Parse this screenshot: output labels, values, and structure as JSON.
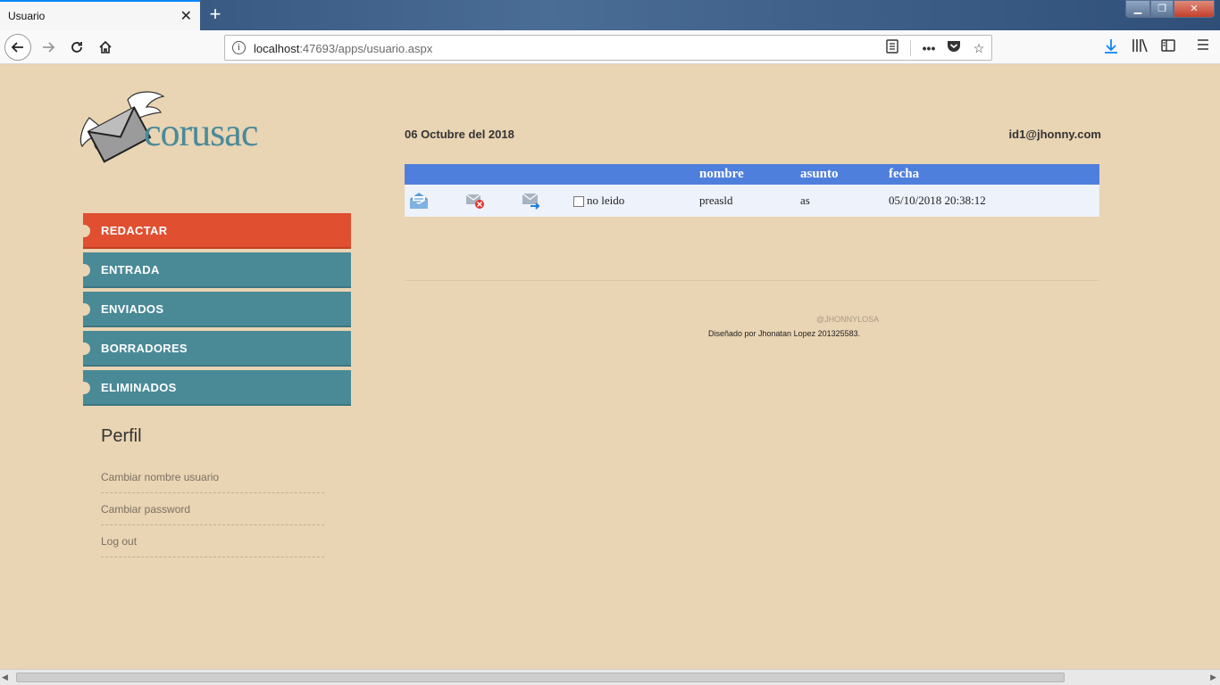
{
  "browser": {
    "tab_title": "Usuario",
    "tab_close": "✕",
    "new_tab": "+",
    "url_host": "localhost",
    "url_rest": ":47693/apps/usuario.aspx",
    "icons": [
      "back-icon",
      "forward-icon",
      "reload-icon",
      "home-icon",
      "info-icon",
      "reader-icon",
      "more-icon",
      "pocket-icon",
      "star-icon",
      "download-icon",
      "library-icon",
      "sidebar-icon",
      "menu-icon"
    ]
  },
  "header": {
    "logo_text": "corusac",
    "date": "06 Octubre del 2018",
    "user_email": "id1@jhonny.com"
  },
  "nav": {
    "items": [
      {
        "label": "REDACTAR"
      },
      {
        "label": "ENTRADA"
      },
      {
        "label": "ENVIADOS"
      },
      {
        "label": "BORRADORES"
      },
      {
        "label": "ELIMINADOS"
      }
    ]
  },
  "perfil": {
    "title": "Perfil",
    "links": [
      "Cambiar nombre usuario",
      "Cambiar password",
      "Log out"
    ]
  },
  "mail_table": {
    "headers": [
      "",
      "",
      "",
      "",
      "nombre",
      "asunto",
      "fecha"
    ],
    "rows": [
      {
        "status": "no leido",
        "nombre": "preasld",
        "asunto": "as",
        "fecha": "05/10/2018 20:38:12"
      }
    ]
  },
  "footer": {
    "handle": "@JHONNYLOSA",
    "credit": "Diseñado por Jhonatan Lopez 201325583."
  },
  "colors": {
    "background": "#e9d4b3",
    "nav_active": "#e04f30",
    "nav_item": "#4a8a97",
    "table_header": "#4f7fdc",
    "logo": "#4a8a9a"
  }
}
